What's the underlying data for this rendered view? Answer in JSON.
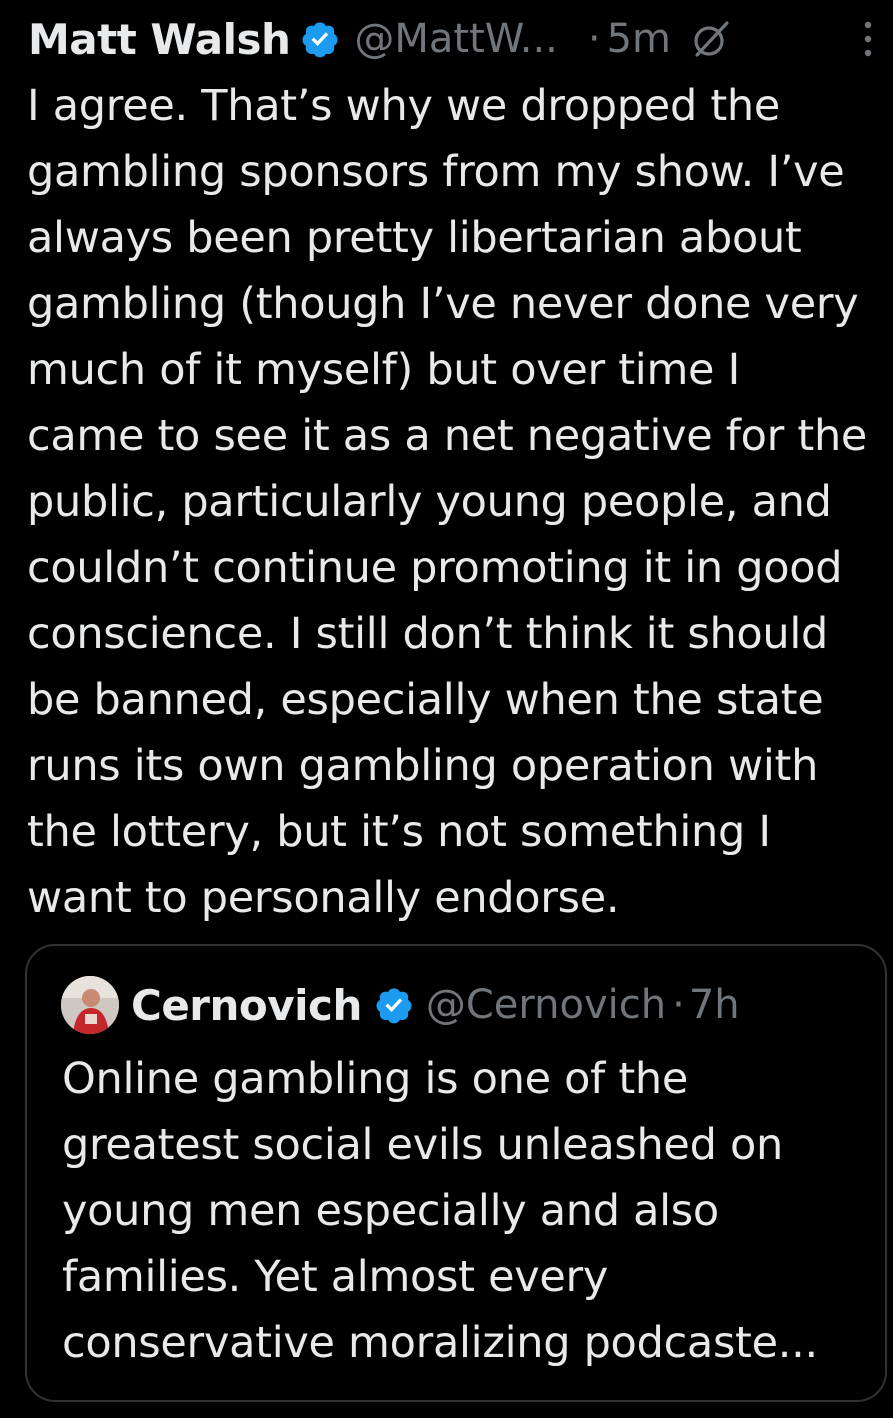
{
  "post": {
    "author_name": "Matt Walsh",
    "handle": "@MattW...",
    "separator": "·",
    "time": "5m",
    "body_lines": [
      "I agree. That’s why we dropped the",
      "gambling sponsors from my show. I’ve",
      "always been pretty libertarian about",
      "gambling (though I’ve never done very",
      "much of it myself) but over time I",
      "came to see it as a net negative for the",
      "public, particularly young people, and",
      "couldn’t continue promoting it in good",
      "conscience. I still don’t think it should",
      "be banned, especially when the state",
      "runs its own gambling operation with",
      "the lottery, but it’s not something I",
      "want to personally endorse."
    ]
  },
  "quoted_post": {
    "author_name": "Cernovich",
    "handle": "@Cernovich",
    "separator": "·",
    "time": "7h",
    "body_lines": [
      "Online gambling is one of the",
      "greatest social evils unleashed on",
      "young men especially and also",
      "families. Yet almost every",
      "conservative moralizing podcaste..."
    ]
  },
  "icons": {
    "verified": "verified-badge-icon",
    "grok": "grok-icon",
    "more": "more-options-icon"
  },
  "colors": {
    "background": "#000000",
    "text": "#e7e9ea",
    "secondary": "#71767b",
    "verified_blue": "#1d9bf0",
    "border": "#2f3336"
  }
}
